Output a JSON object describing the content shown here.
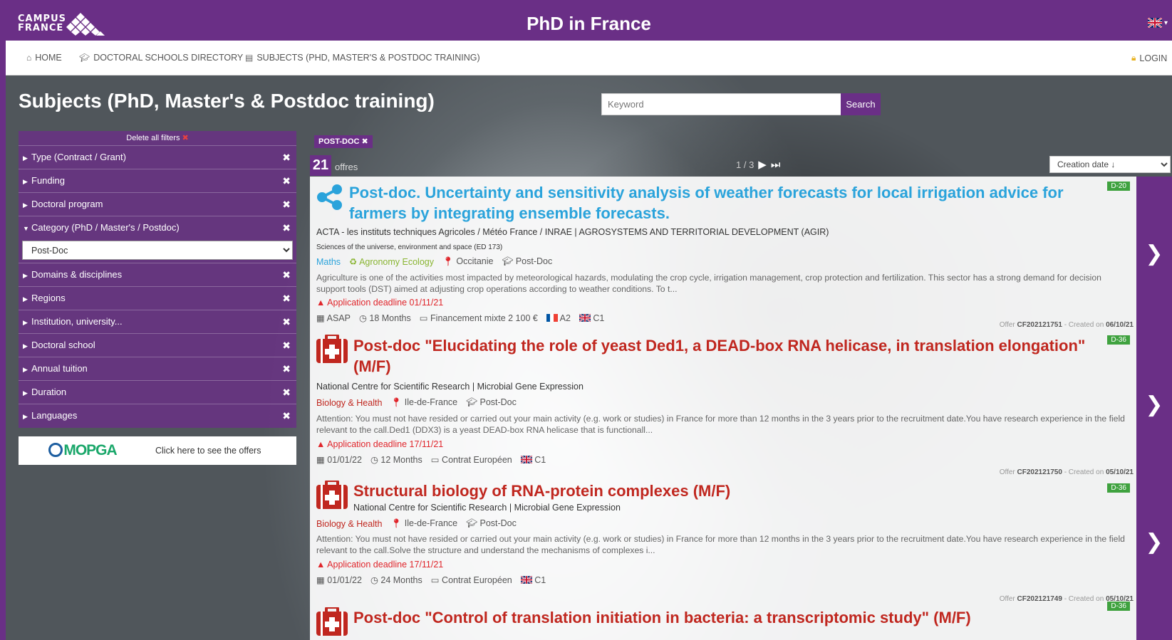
{
  "header": {
    "logo_line1": "CAMPUS",
    "logo_line2": "FRANCE",
    "site_title": "PhD in France"
  },
  "nav": {
    "home": "HOME",
    "doctoral_schools": "DOCTORAL SCHOOLS DIRECTORY",
    "subjects": "SUBJECTS (PHD, MASTER'S & POSTDOC TRAINING)",
    "login": "LOGIN"
  },
  "page": {
    "title": "Subjects (PhD, Master's & Postdoc training)"
  },
  "search": {
    "placeholder": "Keyword",
    "button": "Search"
  },
  "sidebar": {
    "delete_all": "Delete all filters",
    "filters": [
      {
        "label": "Type (Contract / Grant)"
      },
      {
        "label": "Funding"
      },
      {
        "label": "Doctoral program"
      },
      {
        "label": "Category (PhD / Master's / Postdoc)",
        "selected": "Post-Doc"
      },
      {
        "label": "Domains & disciplines"
      },
      {
        "label": "Regions"
      },
      {
        "label": "Institution, university..."
      },
      {
        "label": "Doctoral school"
      },
      {
        "label": "Annual tuition"
      },
      {
        "label": "Duration"
      },
      {
        "label": "Languages"
      }
    ],
    "mopga_logo": "MOPGA",
    "mopga_link": "Click here to see the offers"
  },
  "results": {
    "active_tag": "POST-DOC",
    "count": "21",
    "count_label": "offres",
    "pagination": "1 / 3",
    "sort": "Creation date ↓"
  },
  "offers": [
    {
      "title": "Post-doc. Uncertainty and sensitivity analysis of weather forecasts for local irrigation advice for farmers by integrating ensemble forecasts.",
      "badge": "D-20",
      "org": "ACTA - les instituts techniques Agricoles / Météo France / INRAE | AGROSYSTEMS AND TERRITORIAL DEVELOPMENT (AGIR)",
      "ed": "Sciences of the universe, environment and space (ED 173)",
      "domain1": "Maths",
      "domain2": "Agronomy Ecology",
      "region": "Occitanie",
      "category": "Post-Doc",
      "desc": "Agriculture is one of the activities most impacted by meteorological hazards, modulating the crop cycle, irrigation management, crop protection and fertilization. This sector has a strong demand for decision support tools (DST) aimed at adjusting crop operations according to weather conditions. To t...",
      "deadline": "Application deadline 01/11/21",
      "start": "ASAP",
      "duration": "18 Months",
      "funding": "Financement mixte 2 100 €",
      "lang_fr": "A2",
      "lang_en": "C1",
      "offer_prefix": "Offer",
      "offer_id": "CF202121751",
      "created_prefix": "- Created on",
      "created": "06/10/21"
    },
    {
      "title": "Post-doc \"Elucidating the role of yeast Ded1, a DEAD-box RNA helicase, in translation elongation\" (M/F)",
      "badge": "D-36",
      "org": "National Centre for Scientific Research | Microbial Gene Expression",
      "domain1": "Biology & Health",
      "region": "Ile-de-France",
      "category": "Post-Doc",
      "desc": "Attention: You must not have resided or carried out your main activity (e.g. work or studies) in France for more than 12 months in the 3 years prior to the recruitment date.You have research experience in the field relevant to the call.Ded1 (DDX3) is a yeast DEAD-box RNA helicase that is functionall...",
      "deadline": "Application deadline 17/11/21",
      "start": "01/01/22",
      "duration": "12 Months",
      "funding": "Contrat Européen",
      "lang_en": "C1",
      "offer_prefix": "Offer",
      "offer_id": "CF202121750",
      "created_prefix": "- Created on",
      "created": "05/10/21"
    },
    {
      "title": "Structural biology of RNA-protein complexes (M/F)",
      "badge": "D-36",
      "org": "National Centre for Scientific Research | Microbial Gene Expression",
      "domain1": "Biology & Health",
      "region": "Ile-de-France",
      "category": "Post-Doc",
      "desc": "Attention: You must not have resided or carried out your main activity (e.g. work or studies) in France for more than 12 months in the 3 years prior to the recruitment date.You have research experience in the field relevant to the call.Solve the structure and understand the mechanisms of complexes i...",
      "deadline": "Application deadline 17/11/21",
      "start": "01/01/22",
      "duration": "24 Months",
      "funding": "Contrat Européen",
      "lang_en": "C1",
      "offer_prefix": "Offer",
      "offer_id": "CF202121749",
      "created_prefix": "- Created on",
      "created": "05/10/21"
    },
    {
      "title": "Post-doc \"Control of translation initiation in bacteria: a transcriptomic study\" (M/F)",
      "badge": "D-36"
    }
  ]
}
